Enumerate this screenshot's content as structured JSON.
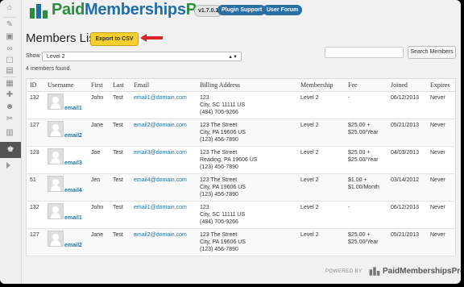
{
  "brand": {
    "name_part1": "Paid",
    "name_part2": "Memberships",
    "name_part3": "Pro",
    "version": "v1.7.0.1",
    "plugin_support": "Plugin Support",
    "user_forum": "User Forum",
    "accent": "#2a8c3c",
    "blue": "#1f6fa6"
  },
  "page": {
    "title": "Members List",
    "export_label": "Export to CSV",
    "search_placeholder": "",
    "search_button": "Search Members",
    "show_label": "Show",
    "level_selected": "Level 2",
    "count_text": "4 members found."
  },
  "table": {
    "headers": [
      "ID",
      "Username",
      "First",
      "Last",
      "Email",
      "Billing Address",
      "Membership",
      "Fee",
      "Joined",
      "Expires"
    ],
    "rows": [
      {
        "id": "132",
        "username": "email1",
        "first": "John",
        "last": "Test",
        "email": "email1@domain.com",
        "addr1": "123",
        "addr2": "City, SC 11111  US",
        "addr3": "(484) 706-9266",
        "membership": "Level 2",
        "fee1": "-",
        "fee2": "",
        "joined": "06/12/2013",
        "expires": "Never"
      },
      {
        "id": "127",
        "username": "email2",
        "first": "Jane",
        "last": "Test",
        "email": "email2@domain.com",
        "addr1": "123 The Street",
        "addr2": "City, PA 19606  US",
        "addr3": "(123) 456-7890",
        "membership": "Level 2",
        "fee1": "$25.00 +",
        "fee2": "$25.00/Year",
        "joined": "05/21/2013",
        "expires": "Never"
      },
      {
        "id": "123",
        "username": "email3",
        "first": "Joe",
        "last": "Test",
        "email": "email3@domain.com",
        "addr1": "123 The Street",
        "addr2": "Reading, PA 19606  US",
        "addr3": "(123) 456-7890",
        "membership": "Level 2",
        "fee1": "$25.00 +",
        "fee2": "$25.00/Year",
        "joined": "04/03/2013",
        "expires": "Never"
      },
      {
        "id": "51",
        "username": "email4",
        "first": "Jen",
        "last": "Test",
        "email": "email4@domain.com",
        "addr1": "123 The Street",
        "addr2": "City, PA 19606  US",
        "addr3": "(123) 456-7890",
        "membership": "Level 2",
        "fee1": "$1.00 +",
        "fee2": "$1.00/Month",
        "joined": "03/14/2012",
        "expires": "Never"
      },
      {
        "id": "132",
        "username": "email1",
        "first": "John",
        "last": "Test",
        "email": "email1@domain.com",
        "addr1": "123",
        "addr2": "City, SC 11111  US",
        "addr3": "(484) 706-9266",
        "membership": "Level 2",
        "fee1": "-",
        "fee2": "",
        "joined": "06/12/2013",
        "expires": "Never"
      },
      {
        "id": "127",
        "username": "email2",
        "first": "Jane",
        "last": "Test",
        "email": "email2@domain.com",
        "addr1": "123 The Street",
        "addr2": "City, PA 19606  US",
        "addr3": "(123) 456-7890",
        "membership": "Level 2",
        "fee1": "$25.00 +",
        "fee2": "$25.00/Year",
        "joined": "05/21/2013",
        "expires": "Never"
      }
    ]
  },
  "footer": {
    "powered_by": "POWERED BY",
    "name": "PaidMembershipsPro"
  },
  "sidebar": {
    "icons": [
      "dashboard-icon",
      "posts-icon",
      "media-icon",
      "links-icon",
      "comments-icon",
      "pages-icon",
      "appearance-icon",
      "plugins-icon",
      "users-icon",
      "tools-icon",
      "settings-icon",
      "memberships-icon",
      "collapse-icon"
    ]
  }
}
